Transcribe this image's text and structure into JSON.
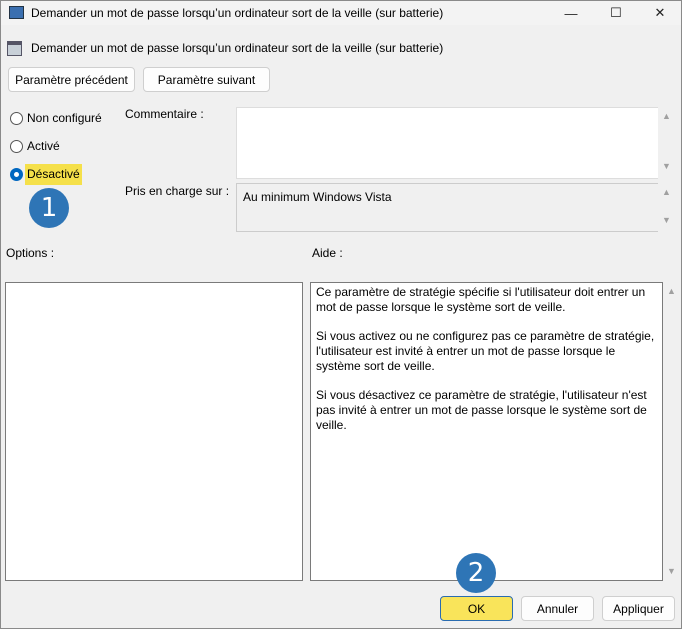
{
  "window": {
    "title": "Demander un mot de passe lorsqu’un ordinateur sort de la veille (sur batterie)",
    "controls": {
      "minimize": "—",
      "maximize": "☐",
      "close": "✕"
    }
  },
  "heading": "Demander un mot de passe lorsqu’un ordinateur sort de la veille (sur batterie)",
  "nav": {
    "previous": "Paramètre précédent",
    "next": "Paramètre suivant"
  },
  "state": {
    "options": [
      {
        "label": "Non configuré",
        "selected": false
      },
      {
        "label": "Activé",
        "selected": false
      },
      {
        "label": "Désactivé",
        "selected": true
      }
    ]
  },
  "comment": {
    "label": "Commentaire :",
    "value": ""
  },
  "supported": {
    "label": "Pris en charge sur :",
    "value": "Au minimum Windows Vista"
  },
  "options_label": "Options :",
  "help_label": "Aide :",
  "help": {
    "paragraphs": [
      "Ce paramètre de stratégie spécifie si l'utilisateur doit entrer un mot de passe lorsque le système sort de veille.",
      "Si vous activez ou ne configurez pas ce paramètre de stratégie, l'utilisateur est invité à entrer un mot de passe lorsque le système sort de veille.",
      "Si vous désactivez ce paramètre de stratégie, l'utilisateur n'est pas invité à entrer un mot de passe lorsque le système sort de veille."
    ]
  },
  "footer": {
    "ok": "OK",
    "cancel": "Annuler",
    "apply": "Appliquer"
  },
  "annotations": {
    "step1": "1",
    "step2": "2"
  },
  "colors": {
    "highlight": "#f5e04a",
    "badge": "#2e75b6",
    "accent": "#0067c0"
  }
}
